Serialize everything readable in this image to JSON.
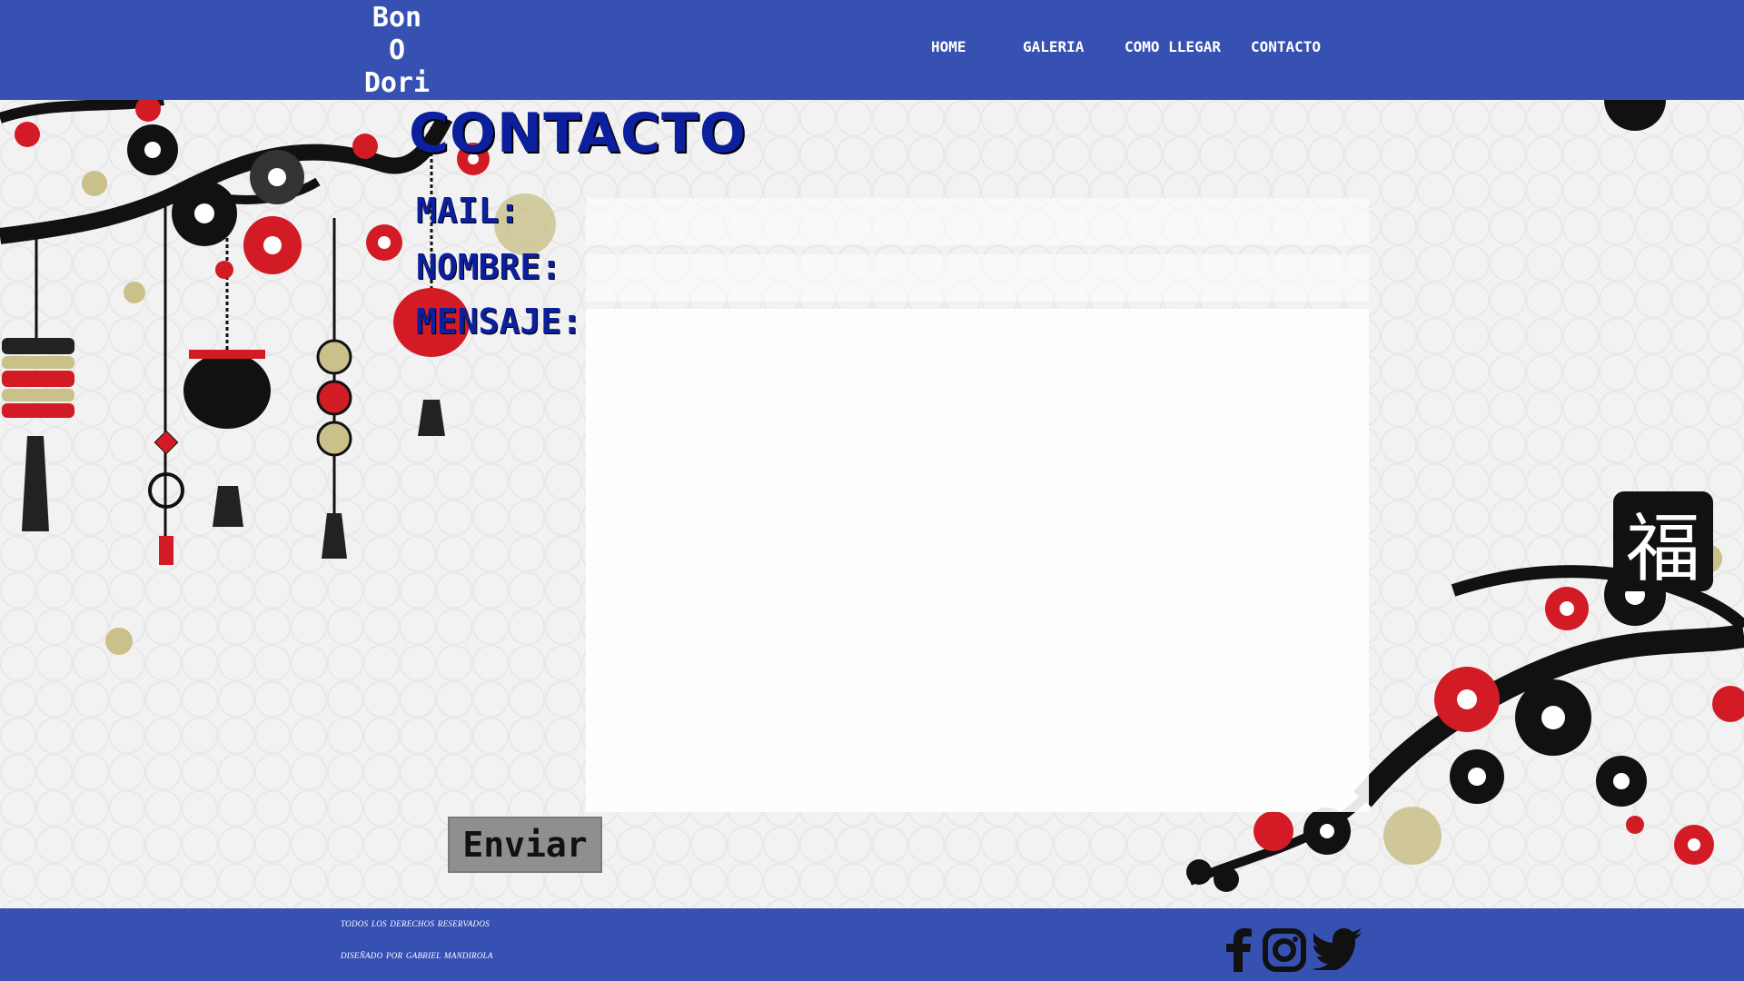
{
  "header": {
    "logo": "Bon\nO\nDori",
    "nav": [
      "HOME",
      "GALERIA",
      "COMO LLEGAR",
      "CONTACTO"
    ]
  },
  "contact": {
    "title": "CONTACTO",
    "mail_label": "MAIL:",
    "name_label": "NOMBRE:",
    "message_label": "MENSAJE:",
    "send_label": "Enviar"
  },
  "footer": {
    "rights": "todos los derechos reservados",
    "designed": "diseñado por gabriel mandirola",
    "social": [
      "facebook-icon",
      "instagram-icon",
      "twitter-icon"
    ]
  },
  "decor": {
    "fuku_char": "福"
  },
  "colors": {
    "bar": "#3751b3",
    "heading": "#0c1f9c",
    "button": "#8f8f8f"
  }
}
